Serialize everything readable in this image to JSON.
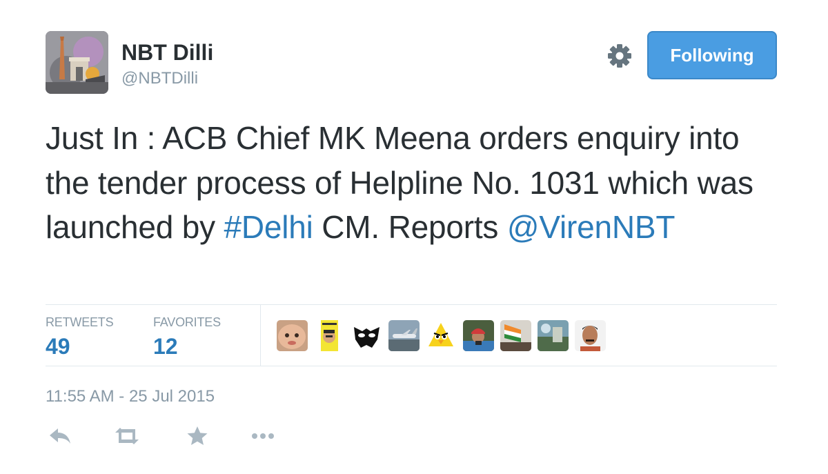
{
  "author": {
    "name": "NBT Dilli",
    "handle": "@NBTDilli"
  },
  "follow_button": {
    "label": "Following"
  },
  "tweet": {
    "text_part1": "Just In : ACB Chief MK Meena orders enquiry into the tender process of Helpline No. 1031 which was launched by ",
    "hashtag": "#Delhi",
    "text_part2": " CM. Reports ",
    "mention": "@VirenNBT"
  },
  "stats": {
    "retweets_label": "RETWEETS",
    "retweets_count": "49",
    "favorites_label": "FAVORITES",
    "favorites_count": "12"
  },
  "favoriter_avatars": [
    "baby-face-avatar",
    "yellow-caricature-avatar",
    "black-mask-avatar",
    "airplane-avatar",
    "angry-bird-avatar",
    "man-in-turban-avatar",
    "indian-flag-crowd-avatar",
    "nature-photo-avatar",
    "man-portrait-avatar"
  ],
  "timestamp": "11:55 AM - 25 Jul 2015",
  "actions": [
    "reply-icon",
    "retweet-icon",
    "favorite-icon",
    "more-icon"
  ],
  "colors": {
    "link": "#2b7bb9",
    "button": "#4a9de2",
    "muted": "#8899a6",
    "text": "#292f33"
  }
}
